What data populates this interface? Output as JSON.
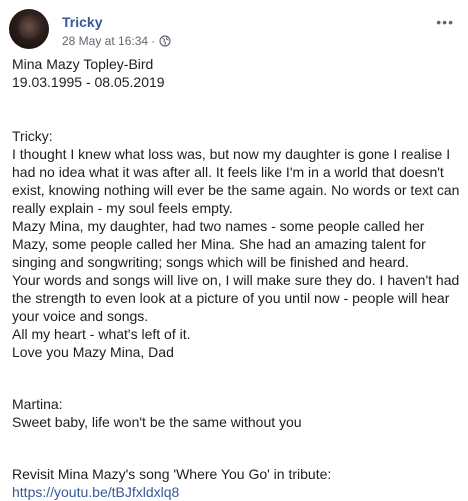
{
  "post": {
    "author": "Tricky",
    "timestamp": "28 May at 16:34",
    "separator": "·",
    "privacy_icon": "globe-icon",
    "more_icon": "more-options-icon",
    "more_glyph": "•••"
  },
  "content": {
    "header_lines": [
      "Mina Mazy Topley-Bird",
      "19.03.1995 - 08.05.2019"
    ],
    "tricky_lines": [
      "Tricky:",
      "I thought I knew what loss was, but now my daughter is gone I realise I",
      "had no idea what it was after all. It feels like I'm in a world that doesn't",
      "exist, knowing nothing will ever be the same again. No words or text can",
      "really explain - my soul feels empty.",
      "Mazy Mina, my daughter, had two names - some people called her",
      "Mazy, some people called her Mina. She had an amazing talent for",
      "singing and songwriting; songs which will be finished and heard.",
      "Your words and songs will live on, I will make sure they do. I haven't had",
      "the strength to even look at a picture of you until now - people will hear",
      "your voice and songs.",
      "All my heart - what's left of it.",
      "Love you Mazy Mina, Dad"
    ],
    "martina_lines": [
      "Martina:",
      "Sweet baby, life won't be the same without you"
    ],
    "revisit_text": "Revisit Mina Mazy's song 'Where You Go' in tribute:",
    "link_text": "https://youtu.be/tBJfxldxlq8"
  }
}
